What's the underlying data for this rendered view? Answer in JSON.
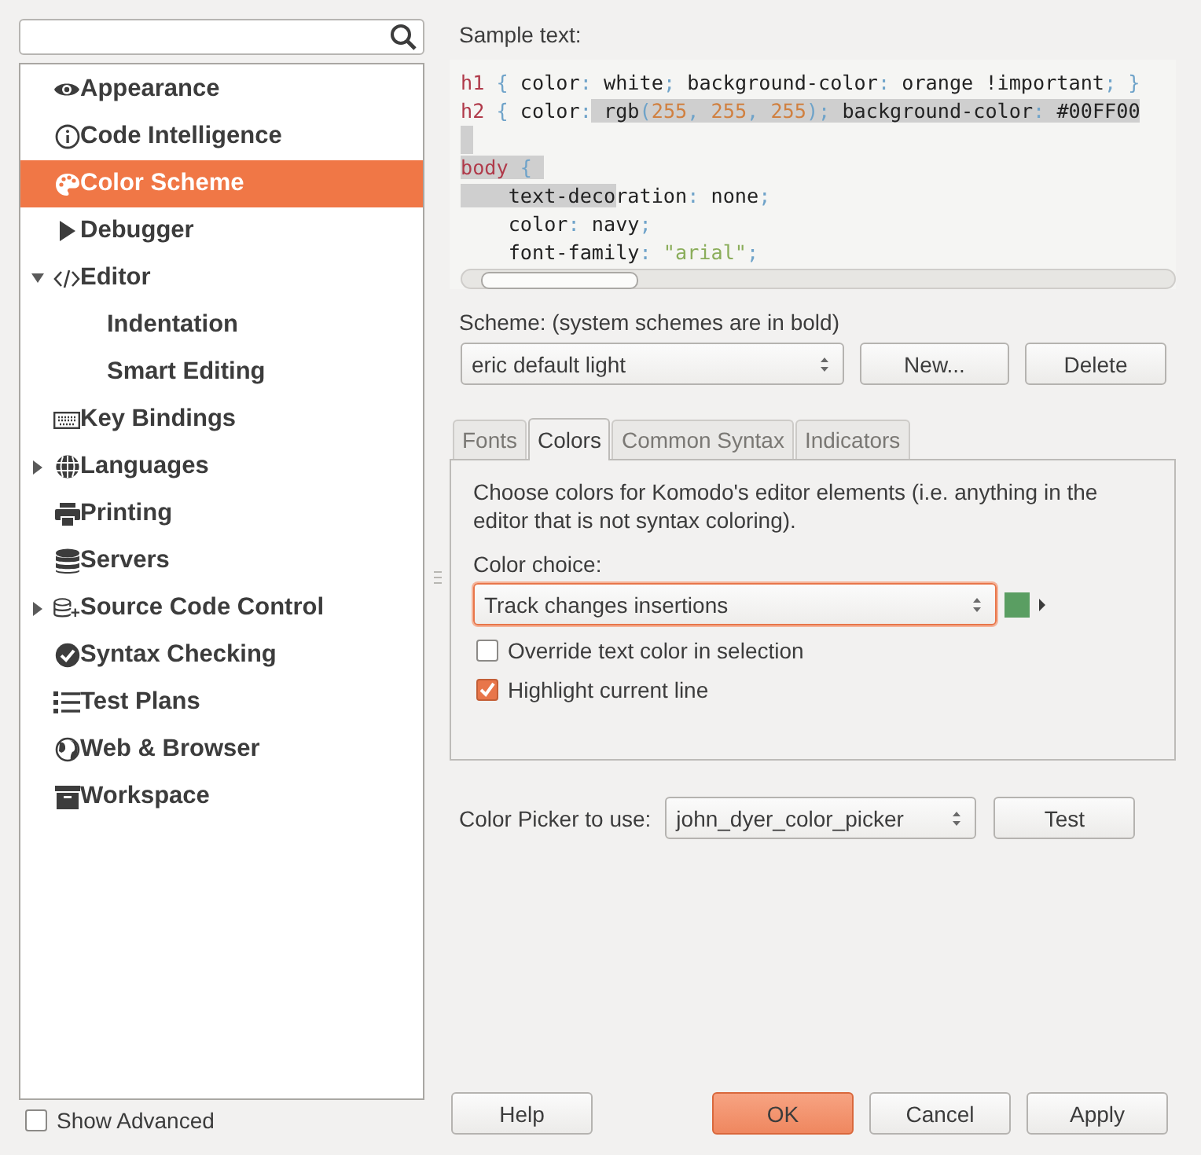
{
  "sidebar": {
    "items": [
      {
        "label": "Appearance",
        "selected": false
      },
      {
        "label": "Code Intelligence",
        "selected": false
      },
      {
        "label": "Color Scheme",
        "selected": true
      },
      {
        "label": "Debugger",
        "selected": false
      },
      {
        "label": "Editor",
        "expanded": true,
        "selected": false,
        "children": [
          {
            "label": "Indentation",
            "selected": false
          },
          {
            "label": "Smart Editing",
            "selected": false
          }
        ]
      },
      {
        "label": "Key Bindings",
        "selected": false
      },
      {
        "label": "Languages",
        "expanded": false,
        "selected": false
      },
      {
        "label": "Printing",
        "selected": false
      },
      {
        "label": "Servers",
        "selected": false
      },
      {
        "label": "Source Code Control",
        "expanded": false,
        "selected": false
      },
      {
        "label": "Syntax Checking",
        "selected": false
      },
      {
        "label": "Test Plans",
        "selected": false
      },
      {
        "label": "Web & Browser",
        "selected": false
      },
      {
        "label": "Workspace",
        "selected": false
      }
    ],
    "show_advanced": {
      "label": "Show Advanced",
      "checked": false
    }
  },
  "sample": {
    "label": "Sample text:",
    "lines": [
      {
        "tokens": [
          {
            "text": "h1",
            "kind": "selector",
            "highlighted": false
          },
          {
            "text": " { ",
            "kind": "punct",
            "highlighted": false
          },
          {
            "text": "color",
            "kind": "prop",
            "highlighted": false
          },
          {
            "text": ":",
            "kind": "punct",
            "highlighted": false
          },
          {
            "text": " white",
            "kind": "value",
            "highlighted": false
          },
          {
            "text": ";",
            "kind": "punct",
            "highlighted": false
          },
          {
            "text": " background-color",
            "kind": "prop",
            "highlighted": false
          },
          {
            "text": ":",
            "kind": "punct",
            "highlighted": false
          },
          {
            "text": " orange !important",
            "kind": "value",
            "highlighted": false
          },
          {
            "text": "; }",
            "kind": "punct",
            "highlighted": false
          }
        ]
      },
      {
        "tokens": [
          {
            "text": "h2",
            "kind": "selector",
            "highlighted": false
          },
          {
            "text": " { ",
            "kind": "punct",
            "highlighted": false
          },
          {
            "text": "color",
            "kind": "prop",
            "highlighted": false
          },
          {
            "text": ":",
            "kind": "punct",
            "highlighted": false
          },
          {
            "text": " rgb",
            "kind": "value",
            "highlighted": true
          },
          {
            "text": "(",
            "kind": "punct",
            "highlighted": true
          },
          {
            "text": "255",
            "kind": "number",
            "highlighted": true
          },
          {
            "text": ", ",
            "kind": "punct",
            "highlighted": true
          },
          {
            "text": "255",
            "kind": "number",
            "highlighted": true
          },
          {
            "text": ", ",
            "kind": "punct",
            "highlighted": true
          },
          {
            "text": "255",
            "kind": "number",
            "highlighted": true
          },
          {
            "text": ");",
            "kind": "punct",
            "highlighted": true
          },
          {
            "text": " background-color",
            "kind": "prop",
            "highlighted": true
          },
          {
            "text": ":",
            "kind": "punct",
            "highlighted": true
          },
          {
            "text": " #00FF00",
            "kind": "value",
            "highlighted": true
          }
        ]
      },
      {
        "highlighted": true
      },
      {
        "tokens": [
          {
            "text": "body",
            "kind": "selector",
            "highlighted": true
          },
          {
            "text": " { ",
            "kind": "punct",
            "highlighted": true
          }
        ]
      },
      {
        "tokens": [
          {
            "text": "    text-deco",
            "kind": "prop",
            "highlighted": true
          },
          {
            "text": "ration",
            "kind": "prop",
            "highlighted": false
          },
          {
            "text": ":",
            "kind": "punct",
            "highlighted": false
          },
          {
            "text": " none",
            "kind": "value",
            "highlighted": false
          },
          {
            "text": ";",
            "kind": "punct",
            "highlighted": false
          }
        ]
      },
      {
        "tokens": [
          {
            "text": "    color",
            "kind": "prop",
            "highlighted": false
          },
          {
            "text": ":",
            "kind": "punct",
            "highlighted": false
          },
          {
            "text": " navy",
            "kind": "value",
            "highlighted": false
          },
          {
            "text": ";",
            "kind": "punct",
            "highlighted": false
          }
        ]
      },
      {
        "tokens": [
          {
            "text": "    font-family",
            "kind": "prop",
            "highlighted": false
          },
          {
            "text": ":",
            "kind": "punct",
            "highlighted": false
          },
          {
            "text": " \"arial\"",
            "kind": "string",
            "highlighted": false
          },
          {
            "text": ";",
            "kind": "punct",
            "highlighted": false
          }
        ]
      }
    ]
  },
  "scheme": {
    "label": "Scheme: (system schemes are in bold)",
    "value": "eric default light",
    "buttons": [
      "New...",
      "Delete"
    ]
  },
  "tabs": [
    {
      "label": "Fonts",
      "selected": false
    },
    {
      "label": "Colors",
      "selected": true
    },
    {
      "label": "Common Syntax",
      "selected": false
    },
    {
      "label": "Indicators",
      "selected": false
    }
  ],
  "colors_panel": {
    "description": "Choose colors for Komodo's editor elements (i.e. anything in the editor that is not syntax coloring).",
    "choice_label": "Color choice:",
    "choice": {
      "value": "Track changes insertions",
      "focused": true
    },
    "swatch": {
      "color": "#5a9e62"
    },
    "checkboxes": [
      {
        "label": "Override text color in selection",
        "checked": false
      },
      {
        "label": "Highlight current line",
        "checked": true
      }
    ]
  },
  "color_picker": {
    "label": "Color Picker to use:",
    "value": "john_dyer_color_picker",
    "button": "Test"
  },
  "buttons": [
    {
      "label": "Help",
      "default": false
    },
    {
      "label": "OK",
      "default": true
    },
    {
      "label": "Cancel",
      "default": false
    },
    {
      "label": "Apply",
      "default": false
    }
  ]
}
